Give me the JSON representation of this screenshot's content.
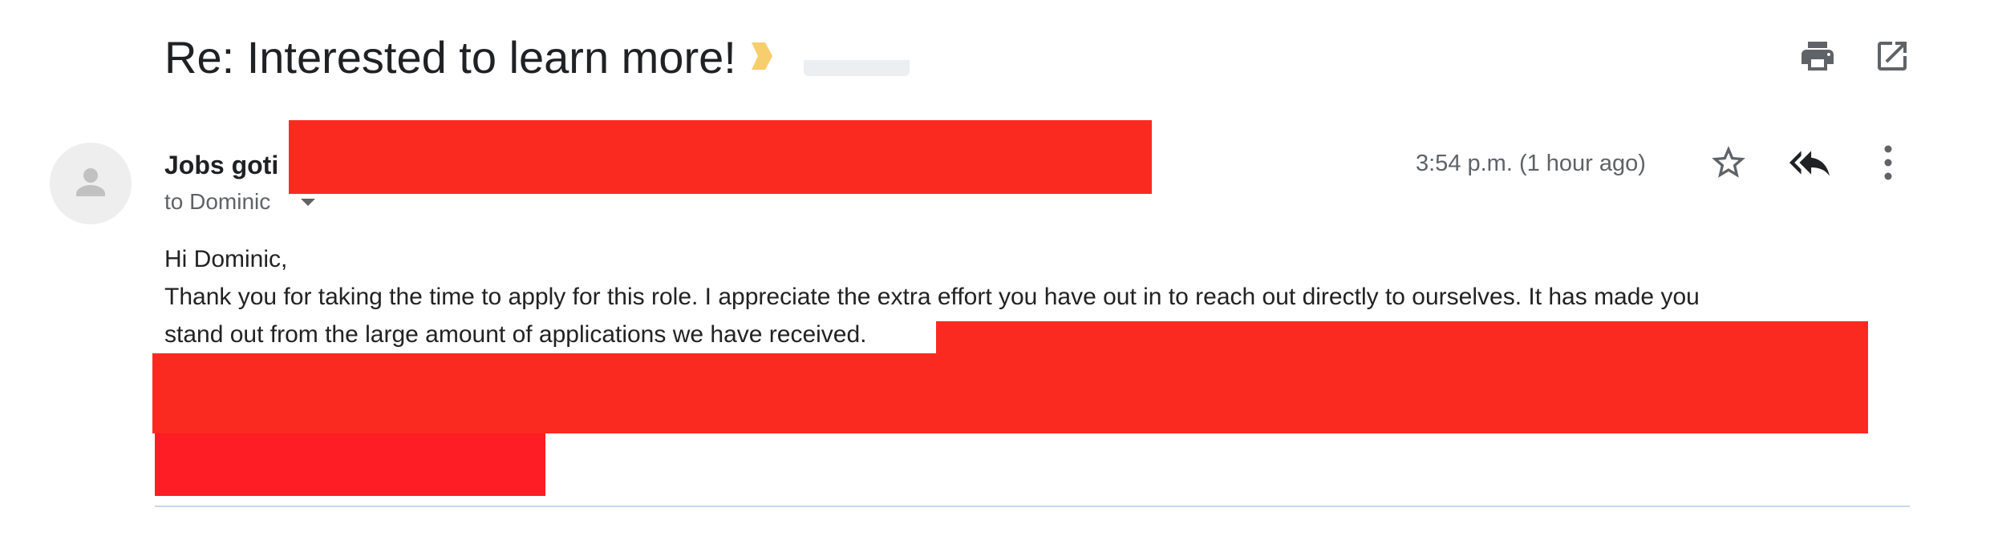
{
  "email": {
    "subject": "Re: Interested to learn more!",
    "sender_name": "Jobs goti",
    "recipient": "to Dominic",
    "timestamp": "3:54 p.m. (1 hour ago)",
    "body": {
      "greeting": "Hi Dominic,",
      "line1": "Thank you for taking the time to apply for this role. I appreciate the extra effort you have out in to reach out directly to ourselves. It has made you",
      "line2": "stand out from the large amount of applications we have received."
    }
  },
  "icons": {
    "importance": "importance-marker-icon",
    "print": "print-icon",
    "open_in_new": "open-in-new-window-icon",
    "avatar": "person-icon",
    "recipient_details": "chevron-down-icon",
    "star": "star-icon",
    "reply_all": "reply-all-icon",
    "more": "more-vertical-icon"
  },
  "colors": {
    "redaction": "#fb2a21",
    "importance": "#f4c542",
    "icon": "#5f6368"
  }
}
